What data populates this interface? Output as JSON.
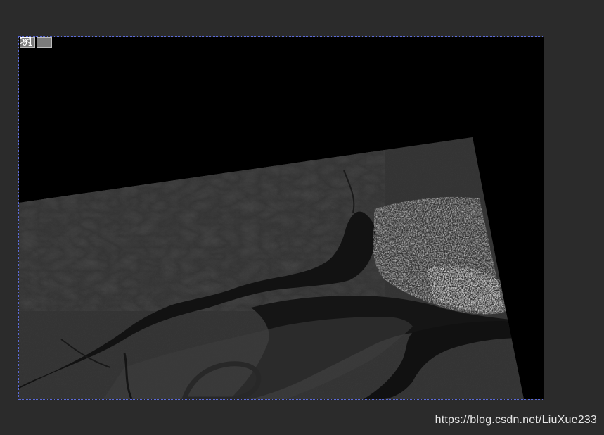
{
  "viewer": {
    "layer_index": "01",
    "display_mode_icon": "envelope-icon"
  },
  "watermark": {
    "text": "https://blog.csdn.net/LiuXue233"
  },
  "colors": {
    "workspace_bg": "#2b2b2b",
    "viewer_bg": "#000000",
    "viewer_border": "#5a6ad8",
    "water": "#141414",
    "land": "#3a3a3a"
  }
}
